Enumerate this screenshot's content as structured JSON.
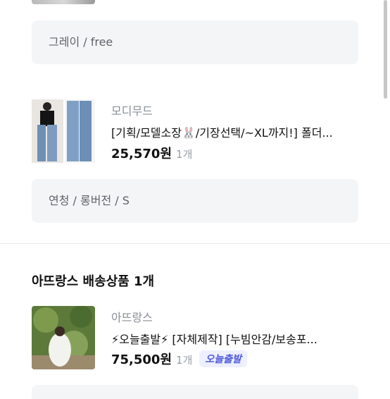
{
  "item1": {
    "option_text": "그레이 / free"
  },
  "item2": {
    "brand": "모디무드",
    "name": "[기획/모델소장🐰/기장선택/~XL까지!] 폴더...",
    "price": "25,570원",
    "qty": "1개",
    "option_text": "연청 / 롱버전 / S"
  },
  "section2": {
    "title": "아뜨랑스 배송상품 1개",
    "item": {
      "brand": "아뜨랑스",
      "name": "⚡오늘출발⚡ [자체제작] [누빔안감/보송포...",
      "price": "75,500원",
      "qty": "1개",
      "badge": "오늘출발"
    }
  },
  "colors": {
    "badge_bg": "#eef0ff",
    "badge_text": "#4e5bd9",
    "option_bg": "#f4f5f7"
  }
}
